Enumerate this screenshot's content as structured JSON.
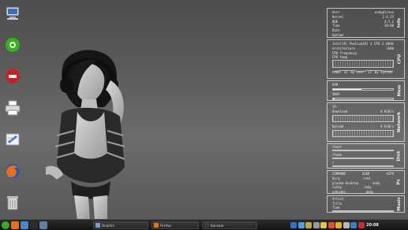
{
  "desktop": {
    "icons": [
      {
        "name": "computer-icon",
        "color": "#cfd8e6"
      },
      {
        "name": "settings-icon",
        "color": "#35b020"
      },
      {
        "name": "trash-full-icon",
        "color": "#c62020"
      },
      {
        "name": "printer-icon",
        "color": "#dcdcdc"
      },
      {
        "name": "text-editor-icon",
        "color": "#3a7bd5"
      },
      {
        "name": "firefox-icon",
        "color": "#e8701a"
      },
      {
        "name": "trash-icon",
        "color": "#d8d8d8"
      }
    ]
  },
  "conky": {
    "info": {
      "tab": "Info",
      "rows": [
        {
          "label": "User",
          "value": "andy@linux"
        },
        {
          "label": "Kernel",
          "value": "2.6.35"
        },
        {
          "label": "KDE",
          "value": "4.5.1"
        },
        {
          "label": "Time",
          "value": "20:08"
        },
        {
          "label": "Date",
          "value": ""
        },
        {
          "label": "Uptime",
          "value": ""
        }
      ]
    },
    "cpu": {
      "tab": "CPU",
      "model": "Intel(R) Pentium(R) 4 CPU 3.40GHz",
      "rows": [
        {
          "label": "Architecture",
          "value": "i686"
        },
        {
          "label": "CPU frequency",
          "value": ""
        },
        {
          "label": "CPU temp",
          "value": ""
        }
      ],
      "load_label": "Load: 31",
      "load_usr": "By user: 12",
      "load_sys": "By system: ",
      "usage_fraction": 0.31
    },
    "mem": {
      "tab": "Mem",
      "ram_label": "RAM",
      "ram_value": "",
      "swap_label": "SWAP",
      "swap_value": "",
      "ram_fraction": 0.47,
      "swap_fraction": 0.02
    },
    "network": {
      "tab": "Network",
      "ip_label": "IP:",
      "ip_value": "",
      "download_label": "Download",
      "download_value": "0 KiB/s",
      "upload_label": "Upload",
      "upload_value": "0 KiB/s"
    },
    "disk": {
      "tab": "Disk",
      "rows": [
        {
          "label": "/boot",
          "value": ""
        },
        {
          "label": "/home",
          "value": ""
        },
        {
          "label": "/",
          "value": ""
        }
      ],
      "fractions": [
        0.62,
        0.55,
        0.48
      ]
    },
    "ps": {
      "tab": "Ps",
      "header": [
        "COMMAND",
        "USER",
        "%CPU"
      ],
      "rows": [
        [
          "Xorg",
          "root",
          ""
        ],
        [
          "plasma-desktop",
          "andy",
          ""
        ],
        [
          "conky",
          "andy",
          ""
        ],
        [
          "yakuake",
          "andy",
          ""
        ]
      ]
    },
    "music": {
      "tab": "Music",
      "rows": [
        {
          "label": "Artist",
          "value": ""
        },
        {
          "label": "Title",
          "value": ""
        },
        {
          "label": "Time",
          "value": ""
        }
      ],
      "progress_fraction": 0.3
    }
  },
  "taskbar": {
    "tasks": [
      {
        "label": "Dolphin",
        "icon_color": "#6fa0d8"
      },
      {
        "label": "Firefox",
        "icon_color": "#e8701a"
      },
      {
        "label": "Konsole",
        "icon_color": "#3c3c3c"
      }
    ],
    "quicklaunch": [
      {
        "name": "kickoff-icon",
        "color": "#3aa82e"
      },
      {
        "name": "firefox-icon",
        "color": "#e8701a"
      },
      {
        "name": "home-icon",
        "color": "#4a86c9"
      },
      {
        "name": "terminal-icon",
        "color": "#2c2c2c"
      },
      {
        "name": "show-desktop-icon",
        "color": "#5f7fa8"
      }
    ],
    "tray": [
      {
        "name": "blue-tray-icon",
        "color": "#3a6cc8"
      },
      {
        "name": "network-tray-icon",
        "color": "#4aa0e0"
      },
      {
        "name": "package-tray-icon",
        "color": "#c8a838"
      },
      {
        "name": "clipboard-tray-icon",
        "color": "#9a9a9a"
      },
      {
        "name": "notes-tray-icon",
        "color": "#d8c850"
      },
      {
        "name": "updates-tray-icon",
        "color": "#e05030"
      },
      {
        "name": "warning-tray-icon",
        "color": "#e0b020"
      },
      {
        "name": "volume-tray-icon",
        "color": "#b8b8b8"
      },
      {
        "name": "kwallet-tray-icon",
        "color": "#3a80c0"
      },
      {
        "name": "device-tray-icon",
        "color": "#c03030"
      }
    ],
    "clock": "20:08"
  }
}
